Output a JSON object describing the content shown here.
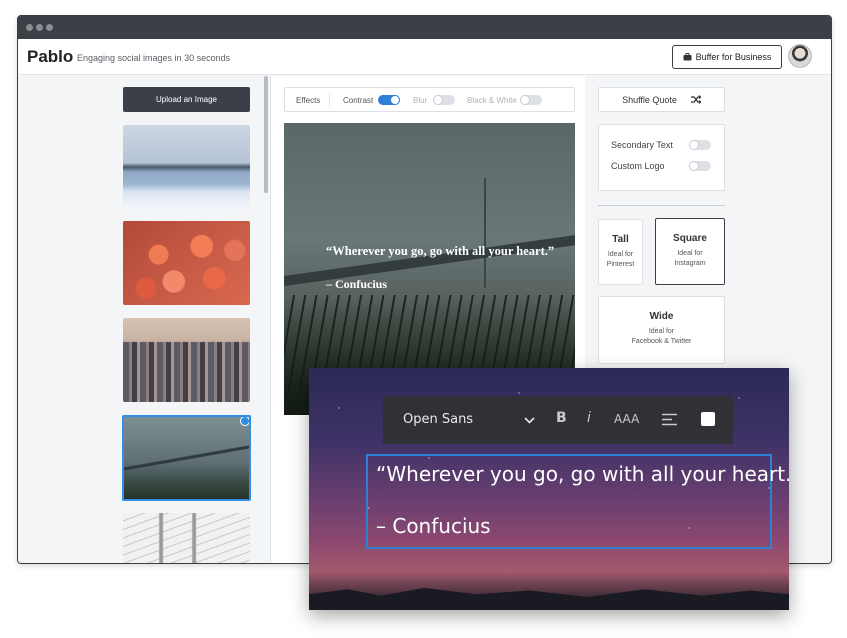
{
  "header": {
    "brand": "Pablo",
    "tagline": "Engaging social images in 30 seconds",
    "business_button": "Buffer for Business"
  },
  "sidebar": {
    "upload_label": "Upload an Image",
    "thumbnails": [
      "snowy-lake",
      "orange-flowers",
      "city-skyline",
      "bridge-grass",
      "golden-gate-bridge"
    ],
    "selected_index": 3
  },
  "effects": {
    "label": "Effects",
    "toggles": [
      {
        "label": "Contrast",
        "on": true
      },
      {
        "label": "Blur",
        "on": false
      },
      {
        "label": "Black & White",
        "on": false
      }
    ]
  },
  "preview": {
    "quote": "“Wherever you go, go with all your heart.”",
    "author": "– Confucius"
  },
  "right_panel": {
    "shuffle_label": "Shuffle Quote",
    "options": [
      {
        "label": "Secondary Text",
        "on": false
      },
      {
        "label": "Custom Logo",
        "on": false
      }
    ],
    "sizes": [
      {
        "title": "Tall",
        "line1": "Ideal for",
        "line2": "Pinterest",
        "active": false
      },
      {
        "title": "Square",
        "line1": "Ideal for",
        "line2": "Instagram",
        "active": true
      },
      {
        "title": "Wide",
        "line1": "Ideal for",
        "line2": "Facebook & Twitter",
        "active": false
      }
    ]
  },
  "editor": {
    "font": "Open Sans",
    "bold": "B",
    "italic": "i",
    "size": "AAA",
    "text_color": "#ffffff",
    "quote": "“Wherever you go, go with all your heart.”",
    "author": "– Confucius"
  },
  "colors": {
    "accent": "#2f7fd6",
    "dark_button": "#3b4048"
  }
}
